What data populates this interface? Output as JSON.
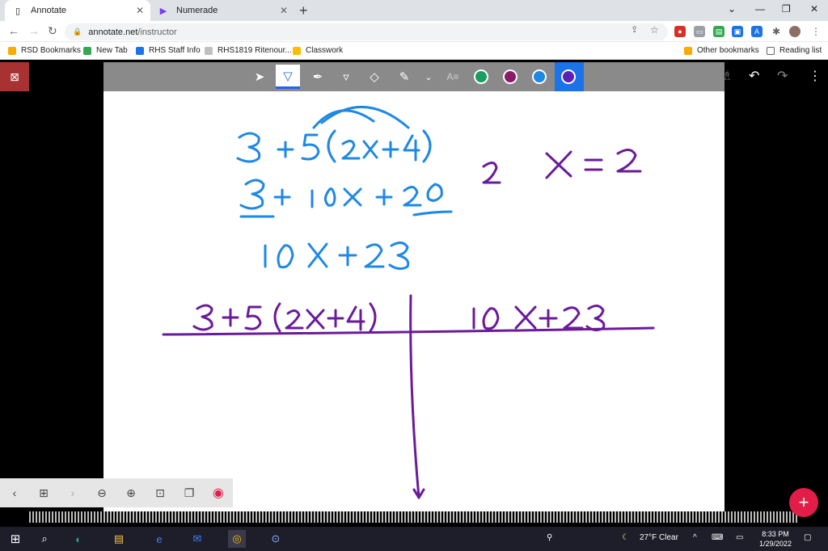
{
  "browser": {
    "tabs": [
      {
        "title": "Annotate",
        "active": true
      },
      {
        "title": "Numerade",
        "active": false
      }
    ],
    "url_host": "annotate.net",
    "url_path": "/instructor",
    "bookmarks": [
      "RSD Bookmarks",
      "New Tab",
      "RHS Staff Info",
      "RHS1819 Ritenour...",
      "Classwork"
    ],
    "other_bookmarks": "Other bookmarks",
    "reading_list": "Reading list"
  },
  "toolbar": {
    "colors": [
      "#1a9e5f",
      "#8b1a6b",
      "#1e88e5",
      "#5b21b6"
    ],
    "selected_color": "#5b21b6"
  },
  "taskbar": {
    "weather": "27°F  Clear",
    "time": "8:33 PM",
    "date": "1/29/2022"
  }
}
